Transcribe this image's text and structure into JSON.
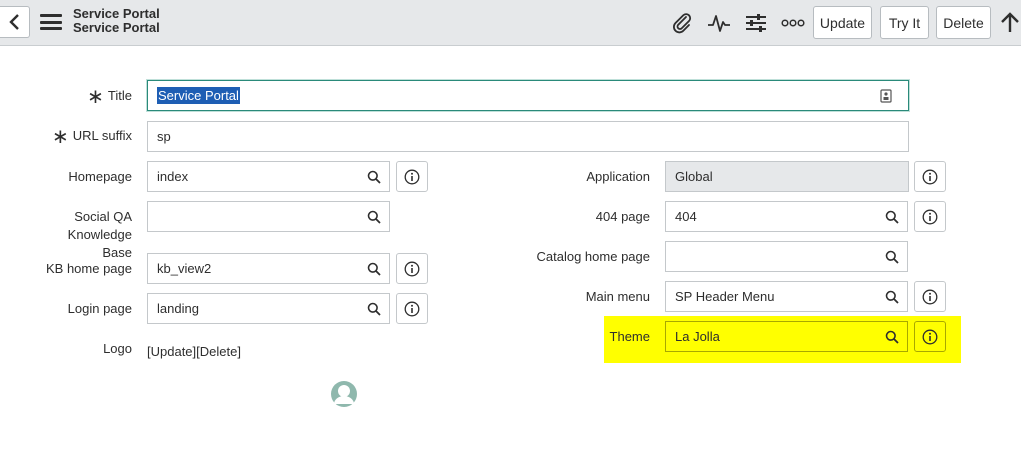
{
  "header": {
    "line1": "Service Portal",
    "line2": "Service Portal",
    "buttons": {
      "update": "Update",
      "try_it": "Try It",
      "delete": "Delete"
    },
    "icons": [
      "chevron-left-icon",
      "menu-icon",
      "paperclip-icon",
      "activity-icon",
      "sliders-icon",
      "more-icon",
      "arrow-up-icon"
    ]
  },
  "form": {
    "title": {
      "label": "Title",
      "value": "Service Portal",
      "required": true
    },
    "url_suffix": {
      "label": "URL suffix",
      "value": "sp",
      "required": true
    },
    "homepage": {
      "label": "Homepage",
      "value": "index"
    },
    "social_qa": {
      "label_line1": "Social QA Knowledge",
      "label_line2": "Base",
      "value": ""
    },
    "kb_home_page": {
      "label": "KB home page",
      "value": "kb_view2"
    },
    "login_page": {
      "label": "Login page",
      "value": "landing"
    },
    "logo": {
      "label": "Logo",
      "update": "[Update]",
      "delete": "[Delete]"
    },
    "application": {
      "label": "Application",
      "value": "Global"
    },
    "page_404": {
      "label": "404 page",
      "value": "404"
    },
    "catalog_home_page": {
      "label": "Catalog home page",
      "value": ""
    },
    "main_menu": {
      "label": "Main menu",
      "value": "SP Header Menu"
    },
    "theme": {
      "label": "Theme",
      "value": "La Jolla"
    }
  },
  "colors": {
    "highlight": "#ffff00",
    "focus": "#2a8a7a",
    "selection": "#1e5eb4"
  }
}
